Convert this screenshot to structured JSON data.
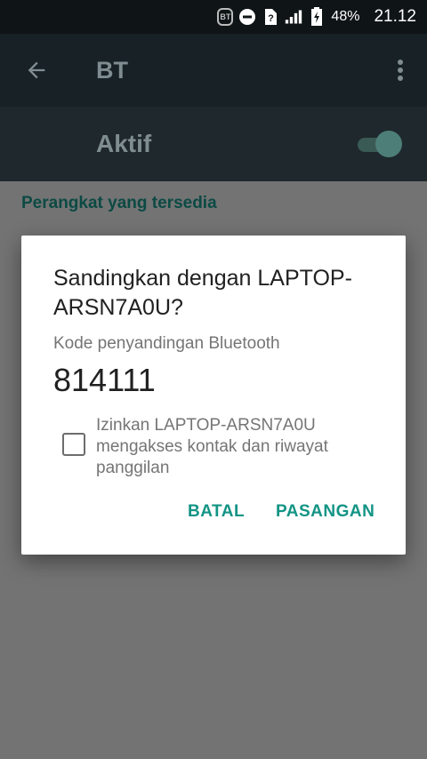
{
  "status_bar": {
    "bt_badge": "BT",
    "battery_percent": "48%",
    "time": "21.12"
  },
  "app_bar": {
    "title": "BT"
  },
  "toggle": {
    "label": "Aktif",
    "state": "on"
  },
  "section": {
    "header": "Perangkat yang tersedia"
  },
  "dialog": {
    "title": "Sandingkan dengan LAPTOP-ARSN7A0U?",
    "code_label": "Kode penyandingan Bluetooth",
    "code": "814111",
    "checkbox_label": "Izinkan LAPTOP-ARSN7A0U mengakses kontak dan riwayat panggilan",
    "checkbox_checked": false,
    "cancel_label": "BATAL",
    "pair_label": "PASANGAN"
  },
  "colors": {
    "accent": "#139485",
    "scrim": "#737373"
  }
}
